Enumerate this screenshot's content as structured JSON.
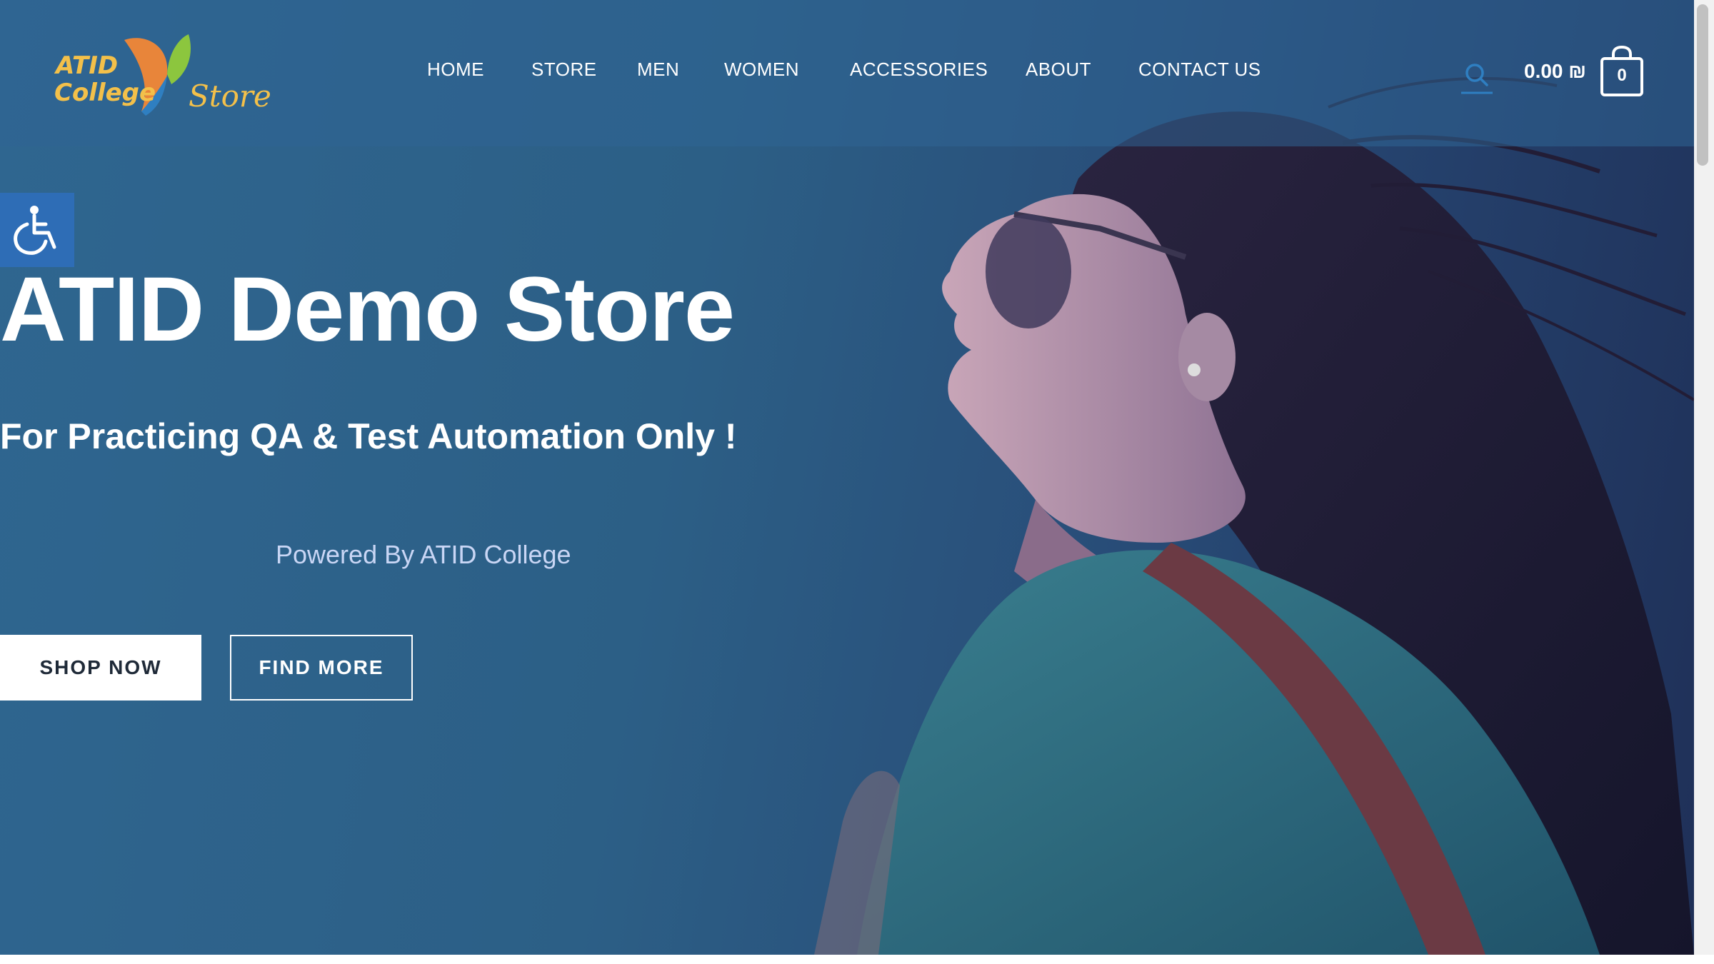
{
  "brand": {
    "logo_top": "ATID",
    "logo_middle": "College",
    "logo_script": "Store"
  },
  "nav": {
    "items": [
      "HOME",
      "STORE",
      "MEN",
      "WOMEN",
      "ACCESSORIES",
      "ABOUT",
      "CONTACT US"
    ]
  },
  "header": {
    "search_icon": "search-icon",
    "cart_amount": "0.00 ₪",
    "cart_count": "0",
    "cart_icon": "shopping-bag-icon"
  },
  "accessibility": {
    "icon": "wheelchair-icon"
  },
  "hero": {
    "title": "ATID Demo Store",
    "subtitle": "For Practicing QA & Test Automation Only !",
    "powered_by": "Powered By ATID College",
    "primary_button": "SHOP NOW",
    "secondary_button": "FIND MORE"
  },
  "colors": {
    "hero_bg": "#2c5f86",
    "logo_gold": "#f3c04a",
    "accessibility_blue": "#2e6db6",
    "powered_text": "#c9d6f5"
  }
}
